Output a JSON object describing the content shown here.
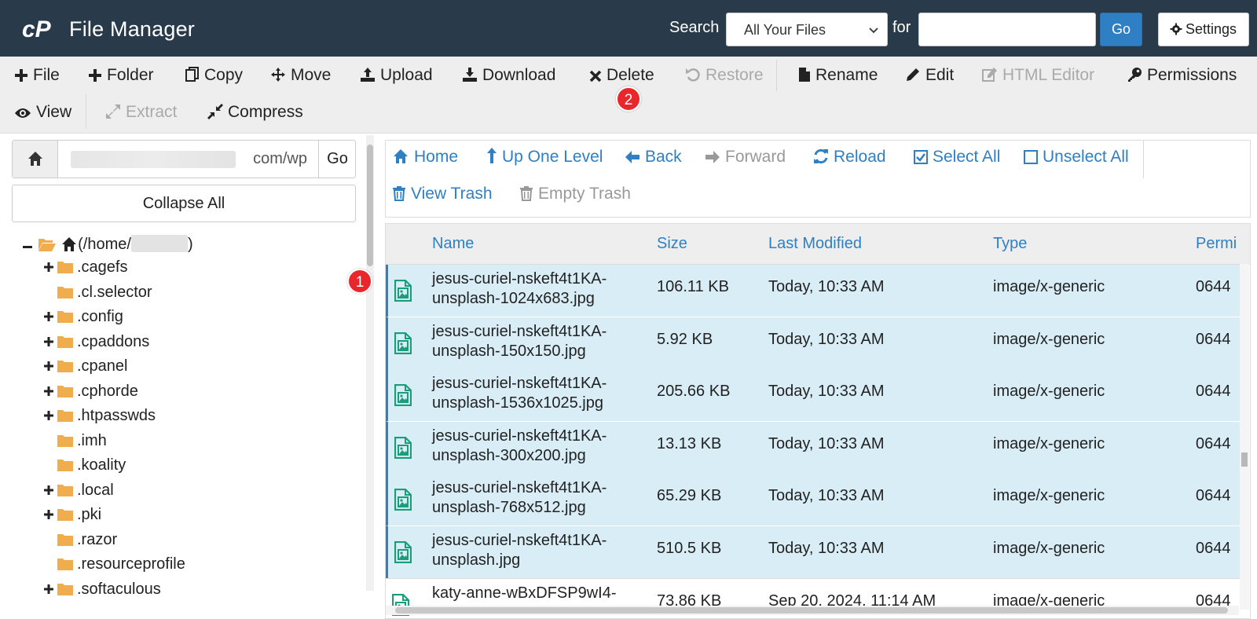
{
  "header": {
    "app_title": "File Manager",
    "search_label": "Search",
    "search_scope": "All Your Files",
    "for_label": "for",
    "search_value": "",
    "go_label": "Go",
    "settings_label": "Settings"
  },
  "toolbar": {
    "file": "File",
    "folder": "Folder",
    "copy": "Copy",
    "move": "Move",
    "upload": "Upload",
    "download": "Download",
    "delete": "Delete",
    "restore": "Restore",
    "rename": "Rename",
    "edit": "Edit",
    "html_editor": "HTML Editor",
    "permissions": "Permissions",
    "view": "View",
    "extract": "Extract",
    "compress": "Compress"
  },
  "annotations": {
    "badge_1": "1",
    "badge_2": "2"
  },
  "sidebar": {
    "path_value": "com/wp",
    "go_label": "Go",
    "collapse_label": "Collapse All",
    "root_prefix": "(/home/",
    "root_suffix": ")",
    "items": [
      {
        "name": ".cagefs",
        "expandable": true
      },
      {
        "name": ".cl.selector",
        "expandable": false
      },
      {
        "name": ".config",
        "expandable": true
      },
      {
        "name": ".cpaddons",
        "expandable": true
      },
      {
        "name": ".cpanel",
        "expandable": true
      },
      {
        "name": ".cphorde",
        "expandable": true
      },
      {
        "name": ".htpasswds",
        "expandable": true
      },
      {
        "name": ".imh",
        "expandable": false
      },
      {
        "name": ".koality",
        "expandable": false
      },
      {
        "name": ".local",
        "expandable": true
      },
      {
        "name": ".pki",
        "expandable": true
      },
      {
        "name": ".razor",
        "expandable": false
      },
      {
        "name": ".resourceprofile",
        "expandable": false
      },
      {
        "name": ".softaculous",
        "expandable": true
      }
    ]
  },
  "nav": {
    "home": "Home",
    "up_one_level": "Up One Level",
    "back": "Back",
    "forward": "Forward",
    "reload": "Reload",
    "select_all": "Select All",
    "unselect_all": "Unselect All",
    "view_trash": "View Trash",
    "empty_trash": "Empty Trash"
  },
  "table": {
    "columns": [
      "Name",
      "Size",
      "Last Modified",
      "Type",
      "Permi"
    ],
    "rows": [
      {
        "name_line1": "jesus-curiel-nskeft4t1KA-",
        "name_line2": "unsplash-1024x683.jpg",
        "size": "106.11 KB",
        "modified": "Today, 10:33 AM",
        "type": "image/x-generic",
        "perm": "0644",
        "selected": true
      },
      {
        "name_line1": "jesus-curiel-nskeft4t1KA-",
        "name_line2": "unsplash-150x150.jpg",
        "size": "5.92 KB",
        "modified": "Today, 10:33 AM",
        "type": "image/x-generic",
        "perm": "0644",
        "selected": true
      },
      {
        "name_line1": "jesus-curiel-nskeft4t1KA-",
        "name_line2": "unsplash-1536x1025.jpg",
        "size": "205.66 KB",
        "modified": "Today, 10:33 AM",
        "type": "image/x-generic",
        "perm": "0644",
        "selected": true
      },
      {
        "name_line1": "jesus-curiel-nskeft4t1KA-",
        "name_line2": "unsplash-300x200.jpg",
        "size": "13.13 KB",
        "modified": "Today, 10:33 AM",
        "type": "image/x-generic",
        "perm": "0644",
        "selected": true
      },
      {
        "name_line1": "jesus-curiel-nskeft4t1KA-",
        "name_line2": "unsplash-768x512.jpg",
        "size": "65.29 KB",
        "modified": "Today, 10:33 AM",
        "type": "image/x-generic",
        "perm": "0644",
        "selected": true
      },
      {
        "name_line1": "jesus-curiel-nskeft4t1KA-",
        "name_line2": "unsplash.jpg",
        "size": "510.5 KB",
        "modified": "Today, 10:33 AM",
        "type": "image/x-generic",
        "perm": "0644",
        "selected": true
      },
      {
        "name_line1": "katy-anne-wBxDFSP9wI4-",
        "name_line2": "",
        "size": "73.86 KB",
        "modified": "Sep 20, 2024, 11:14 AM",
        "type": "image/x-generic",
        "perm": "0644",
        "selected": false
      }
    ]
  },
  "colors": {
    "header_bg": "#293a4a",
    "accent": "#2f7fc5",
    "selected_row": "#d9edf7",
    "badge": "#e8262b",
    "folder": "#f0ad4e",
    "file_icon": "#1a9e7a"
  }
}
